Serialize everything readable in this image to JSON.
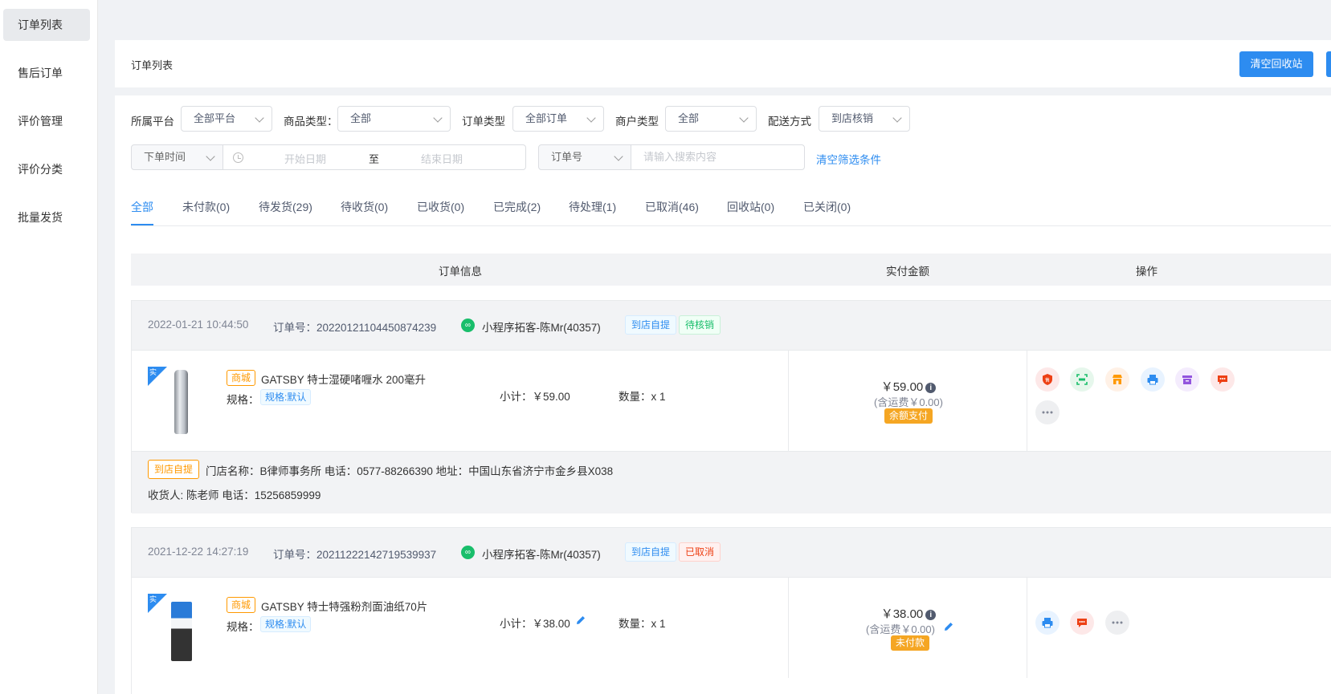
{
  "sidebar": {
    "items": [
      {
        "label": "订单列表",
        "active": true
      },
      {
        "label": "售后订单"
      },
      {
        "label": "评价管理"
      },
      {
        "label": "评价分类"
      },
      {
        "label": "批量发货"
      }
    ]
  },
  "header": {
    "title": "订单列表",
    "clear_recycle_button": "清空回收站"
  },
  "filters": {
    "platform_label": "所属平台",
    "platform_value": "全部平台",
    "goods_type_label": "商品类型：",
    "goods_type_value": "全部",
    "order_type_label": "订单类型",
    "order_type_value": "全部订单",
    "merchant_type_label": "商户类型",
    "merchant_type_value": "全部",
    "delivery_label": "配送方式",
    "delivery_value": "到店核销",
    "time_type": "下单时间",
    "start_placeholder": "开始日期",
    "range_sep": "至",
    "end_placeholder": "结束日期",
    "search_field": "订单号",
    "search_placeholder": "请输入搜索内容",
    "clear_link": "清空筛选条件"
  },
  "tabs": [
    {
      "label": "全部",
      "active": true
    },
    {
      "label": "未付款(0)"
    },
    {
      "label": "待发货(29)"
    },
    {
      "label": "待收货(0)"
    },
    {
      "label": "已收货(0)"
    },
    {
      "label": "已完成(2)"
    },
    {
      "label": "待处理(1)"
    },
    {
      "label": "已取消(46)"
    },
    {
      "label": "回收站(0)"
    },
    {
      "label": "已关闭(0)"
    }
  ],
  "table_header": {
    "info": "订单信息",
    "amount": "实付金额",
    "ops": "操作"
  },
  "orders": [
    {
      "time": "2022-01-21 10:44:50",
      "order_no": "订单号：2022012110445087423​9",
      "wechat_icon": "mini-program-icon",
      "customer": "小程序拓客-陈Mr(40357)",
      "tag1": "到店自提",
      "tag2": "待核销",
      "mall_tag": "商城",
      "corner": "实",
      "product_name": "GATSBY 特士湿硬啫喱水 200毫升",
      "spec_label": "规格：",
      "spec_value": "规格:默认",
      "subtotal": "小计：￥59.00",
      "quantity": "数量：x 1",
      "amount": "￥59.00",
      "shipping": "(含运费￥0.00)",
      "pay_method": "余额支付",
      "store_tag": "到店自提",
      "store_info": "门店名称：B律师事务所 电话：0577-88266390 地址：中国山东省济宁市金乡县X038",
      "receiver": "收货人: 陈老师 电话：15256859999"
    },
    {
      "time": "2021-12-22 14:27:19",
      "order_no": "订单号：20211222142719539937",
      "customer": "小程序拓客-陈Mr(40357)",
      "tag1": "到店自提",
      "tag2": "已取消",
      "mall_tag": "商城",
      "corner": "实",
      "product_name": "GATSBY 特士特强粉剂面油纸70片",
      "spec_label": "规格：",
      "spec_value": "规格:默认",
      "subtotal": "小计：￥38.00",
      "quantity": "数量：x 1",
      "amount": "￥38.00",
      "shipping": "(含运费￥0.00)",
      "pay_method": "未付款"
    }
  ],
  "colors": {
    "primary": "#2d8cf0",
    "success": "#19be6b",
    "warning": "#f5a623",
    "danger": "#ed4014"
  },
  "op_icons": [
    "after-sale-icon",
    "verify-icon",
    "store-icon",
    "print-icon",
    "archive-icon",
    "message-icon",
    "more-icon"
  ]
}
